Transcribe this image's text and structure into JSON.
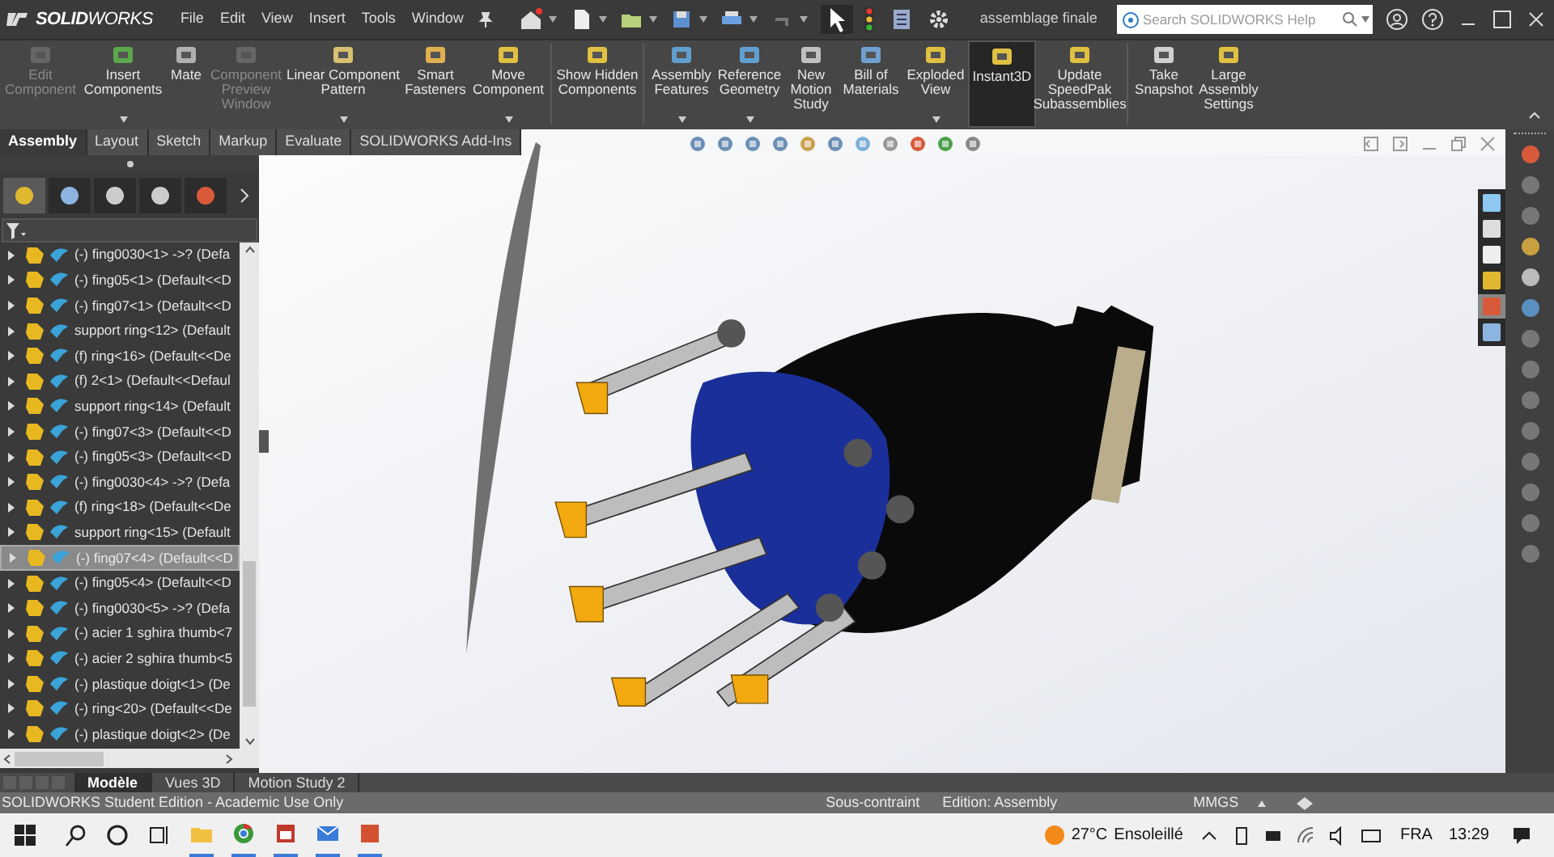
{
  "title_bar": {
    "logo": "**SOLID**WORKS",
    "menus": [
      "File",
      "Edit",
      "View",
      "Insert",
      "Tools",
      "Window"
    ],
    "document_title": "assemblage finale",
    "search": {
      "placeholder": "Search SOLIDWORKS Help"
    }
  },
  "ribbon": [
    {
      "label": "Edit Component",
      "disabled": true,
      "active": false,
      "dropdown": false
    },
    {
      "label": "Insert Components",
      "disabled": false,
      "active": false,
      "dropdown": true
    },
    {
      "label": "Mate",
      "disabled": false,
      "active": false,
      "dropdown": false
    },
    {
      "label": "Component Preview Window",
      "disabled": true,
      "active": false,
      "dropdown": false
    },
    {
      "label": "Linear Component Pattern",
      "disabled": false,
      "active": false,
      "dropdown": true
    },
    {
      "label": "Smart Fasteners",
      "disabled": false,
      "active": false,
      "dropdown": false
    },
    {
      "label": "Move Component",
      "disabled": false,
      "active": false,
      "dropdown": true
    },
    {
      "label": "Show Hidden Components",
      "disabled": false,
      "active": false,
      "dropdown": false
    },
    {
      "label": "Assembly Features",
      "disabled": false,
      "active": false,
      "dropdown": true
    },
    {
      "label": "Reference Geometry",
      "disabled": false,
      "active": false,
      "dropdown": true
    },
    {
      "label": "New Motion Study",
      "disabled": false,
      "active": false,
      "dropdown": false
    },
    {
      "label": "Bill of Materials",
      "disabled": false,
      "active": false,
      "dropdown": false
    },
    {
      "label": "Exploded View",
      "disabled": false,
      "active": false,
      "dropdown": true
    },
    {
      "label": "Instant3D",
      "disabled": false,
      "active": true,
      "dropdown": false
    },
    {
      "label": "Update SpeedPak Subassemblies",
      "disabled": false,
      "active": false,
      "dropdown": false
    },
    {
      "label": "Take Snapshot",
      "disabled": false,
      "active": false,
      "dropdown": false
    },
    {
      "label": "Large Assembly Settings",
      "disabled": false,
      "active": false,
      "dropdown": false
    }
  ],
  "command_tabs": [
    {
      "label": "Assembly",
      "selected": true
    },
    {
      "label": "Layout",
      "selected": false
    },
    {
      "label": "Sketch",
      "selected": false
    },
    {
      "label": "Markup",
      "selected": false
    },
    {
      "label": "Evaluate",
      "selected": false
    },
    {
      "label": "SOLIDWORKS Add-Ins",
      "selected": false
    }
  ],
  "feature_tree": [
    {
      "label": "(-) fing0030<1> ->? (Defa",
      "selected": false
    },
    {
      "label": "(-) fing05<1> (Default<<D",
      "selected": false
    },
    {
      "label": "(-) fing07<1> (Default<<D",
      "selected": false
    },
    {
      "label": "support ring<12> (Default",
      "selected": false
    },
    {
      "label": "(f) ring<16> (Default<<De",
      "selected": false
    },
    {
      "label": "(f) 2<1> (Default<<Defaul",
      "selected": false
    },
    {
      "label": "support ring<14> (Default",
      "selected": false
    },
    {
      "label": "(-) fing07<3> (Default<<D",
      "selected": false
    },
    {
      "label": "(-) fing05<3> (Default<<D",
      "selected": false
    },
    {
      "label": "(-) fing0030<4> ->? (Defa",
      "selected": false
    },
    {
      "label": "(f) ring<18> (Default<<De",
      "selected": false
    },
    {
      "label": "support ring<15> (Default",
      "selected": false
    },
    {
      "label": "(-) fing07<4> (Default<<D",
      "selected": true
    },
    {
      "label": "(-) fing05<4> (Default<<D",
      "selected": false
    },
    {
      "label": "(-) fing0030<5> ->? (Defa",
      "selected": false
    },
    {
      "label": "(-) acier 1 sghira thumb<7",
      "selected": false
    },
    {
      "label": "(-) acier 2 sghira thumb<5",
      "selected": false
    },
    {
      "label": "(-) plastique doigt<1> (De",
      "selected": false
    },
    {
      "label": "(-) ring<20> (Default<<De",
      "selected": false
    },
    {
      "label": "(-) plastique doigt<2> (De",
      "selected": false
    }
  ],
  "bottom_tabs": [
    {
      "label": "Modèle",
      "selected": true
    },
    {
      "label": "Vues 3D",
      "selected": false
    },
    {
      "label": "Motion Study 2",
      "selected": false
    }
  ],
  "status_bar": {
    "edition": "SOLIDWORKS Student Edition - Academic Use Only",
    "constraint": "Sous-contraint",
    "mode": "Edition: Assembly",
    "units": "MMGS"
  },
  "taskbar": {
    "temperature": "27°C",
    "weather": "Ensoleillé",
    "language": "FRA",
    "time": "13:29"
  }
}
